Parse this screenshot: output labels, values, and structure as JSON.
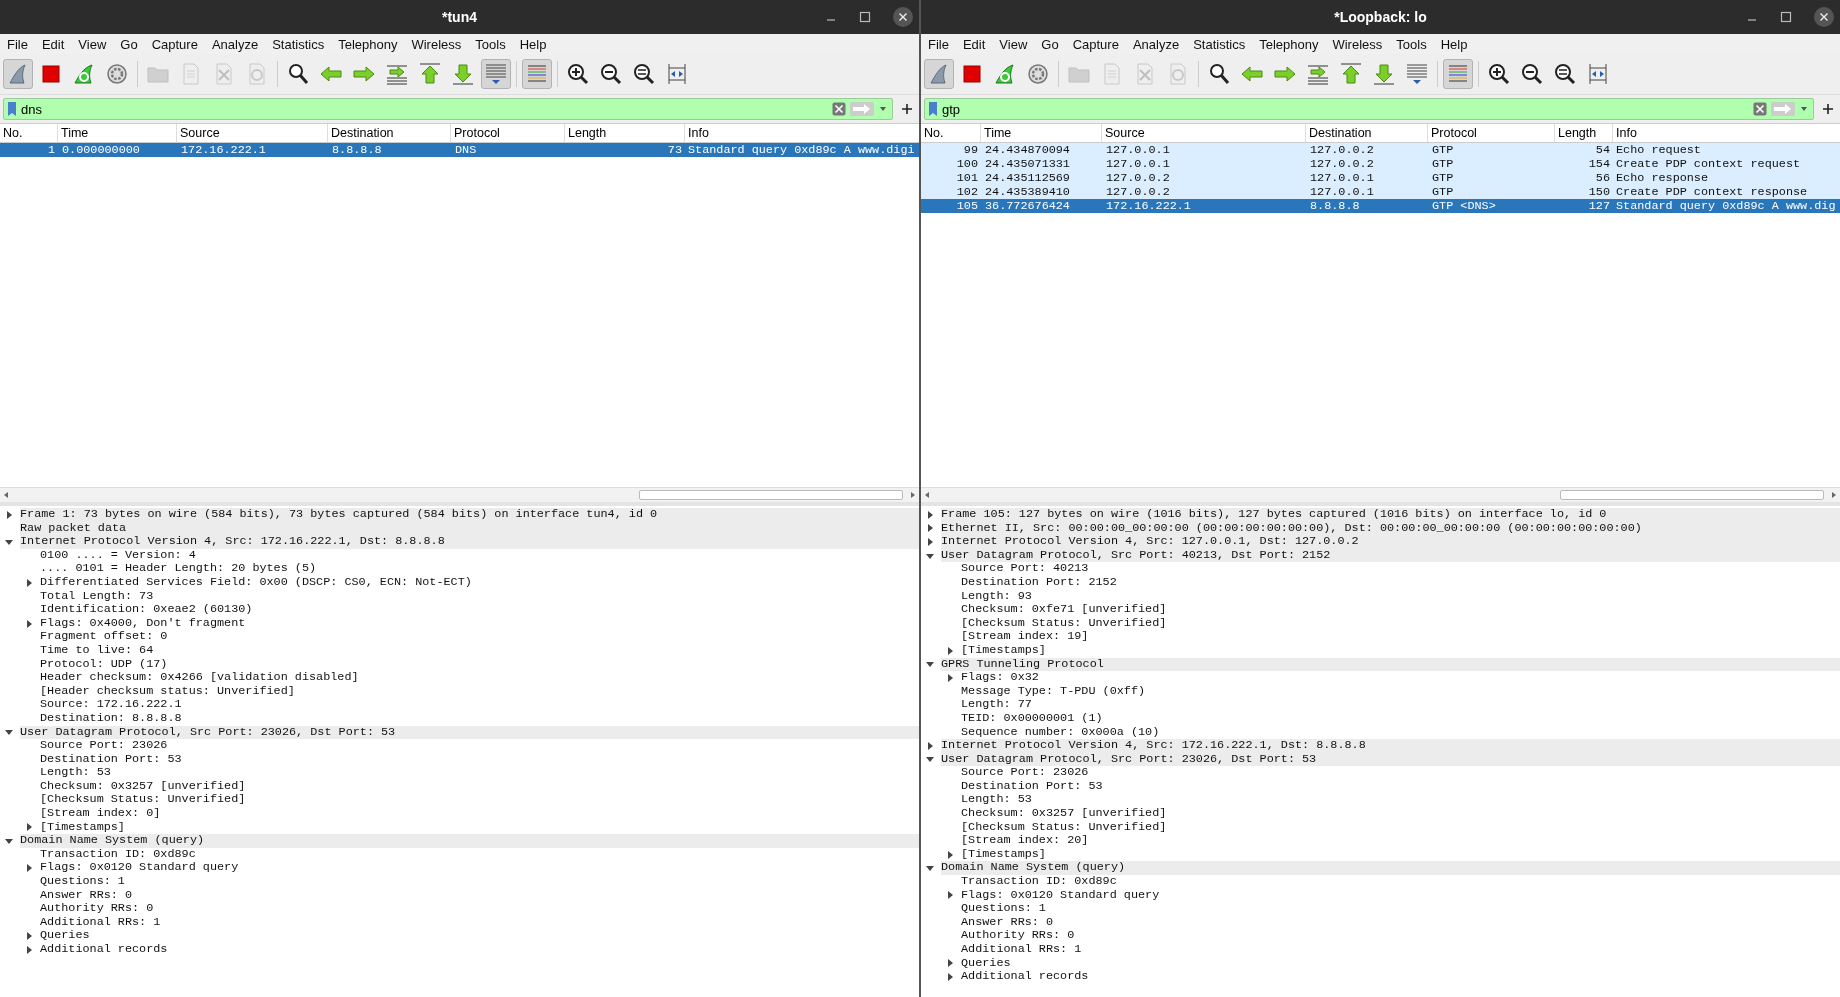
{
  "windows": [
    {
      "title": "*tun4",
      "menu": [
        "File",
        "Edit",
        "View",
        "Go",
        "Capture",
        "Analyze",
        "Statistics",
        "Telephony",
        "Wireless",
        "Tools",
        "Help"
      ],
      "toolbar": [
        {
          "kind": "start",
          "pressed": true,
          "disabled": false
        },
        {
          "kind": "stop",
          "pressed": false,
          "disabled": false
        },
        {
          "kind": "restart",
          "pressed": false,
          "disabled": false
        },
        {
          "kind": "options",
          "pressed": false,
          "disabled": false
        },
        {
          "kind": "separator"
        },
        {
          "kind": "open",
          "pressed": false,
          "disabled": true
        },
        {
          "kind": "save",
          "pressed": false,
          "disabled": true
        },
        {
          "kind": "close",
          "pressed": false,
          "disabled": true
        },
        {
          "kind": "reload",
          "pressed": false,
          "disabled": true
        },
        {
          "kind": "separator"
        },
        {
          "kind": "find",
          "pressed": false,
          "disabled": false
        },
        {
          "kind": "back",
          "pressed": false,
          "disabled": false
        },
        {
          "kind": "forward",
          "pressed": false,
          "disabled": false
        },
        {
          "kind": "goto",
          "pressed": false,
          "disabled": false
        },
        {
          "kind": "first",
          "pressed": false,
          "disabled": false
        },
        {
          "kind": "last",
          "pressed": false,
          "disabled": false
        },
        {
          "kind": "autoscroll",
          "pressed": true,
          "disabled": false
        },
        {
          "kind": "separator"
        },
        {
          "kind": "colorize",
          "pressed": true,
          "disabled": false
        },
        {
          "kind": "separator"
        },
        {
          "kind": "zoom_in",
          "pressed": false,
          "disabled": false
        },
        {
          "kind": "zoom_out",
          "pressed": false,
          "disabled": false
        },
        {
          "kind": "zoom_reset",
          "pressed": false,
          "disabled": false
        },
        {
          "kind": "resize",
          "pressed": false,
          "disabled": false
        }
      ],
      "filter": {
        "value": "dns"
      },
      "columns": [
        "No.",
        "Time",
        "Source",
        "Destination",
        "Protocol",
        "Length",
        "Info"
      ],
      "packets": [
        {
          "no": "1",
          "time": "0.000000000",
          "source": "172.16.222.1",
          "destination": "8.8.8.8",
          "protocol": "DNS",
          "length": "73",
          "info": "Standard query 0xd89c A www.digi",
          "selected": true
        }
      ],
      "details": [
        {
          "text": "Frame 1: 73 bytes on wire (584 bits), 73 bytes captured (584 bits) on interface tun4, id 0",
          "kind": "branch",
          "expanded": false
        },
        {
          "text": "Raw packet data",
          "kind": "leaf"
        },
        {
          "text": "Internet Protocol Version 4, Src: 172.16.222.1, Dst: 8.8.8.8",
          "kind": "branch",
          "expanded": true,
          "children": [
            {
              "text": "0100 .... = Version: 4",
              "kind": "leaf"
            },
            {
              "text": ".... 0101 = Header Length: 20 bytes (5)",
              "kind": "leaf"
            },
            {
              "text": "Differentiated Services Field: 0x00 (DSCP: CS0, ECN: Not-ECT)",
              "kind": "branch",
              "expanded": false
            },
            {
              "text": "Total Length: 73",
              "kind": "leaf"
            },
            {
              "text": "Identification: 0xeae2 (60130)",
              "kind": "leaf"
            },
            {
              "text": "Flags: 0x4000, Don't fragment",
              "kind": "branch",
              "expanded": false
            },
            {
              "text": "Fragment offset: 0",
              "kind": "leaf"
            },
            {
              "text": "Time to live: 64",
              "kind": "leaf"
            },
            {
              "text": "Protocol: UDP (17)",
              "kind": "leaf"
            },
            {
              "text": "Header checksum: 0x4266 [validation disabled]",
              "kind": "leaf"
            },
            {
              "text": "[Header checksum status: Unverified]",
              "kind": "leaf"
            },
            {
              "text": "Source: 172.16.222.1",
              "kind": "leaf"
            },
            {
              "text": "Destination: 8.8.8.8",
              "kind": "leaf"
            }
          ]
        },
        {
          "text": "User Datagram Protocol, Src Port: 23026, Dst Port: 53",
          "kind": "branch",
          "expanded": true,
          "children": [
            {
              "text": "Source Port: 23026",
              "kind": "leaf"
            },
            {
              "text": "Destination Port: 53",
              "kind": "leaf"
            },
            {
              "text": "Length: 53",
              "kind": "leaf"
            },
            {
              "text": "Checksum: 0x3257 [unverified]",
              "kind": "leaf"
            },
            {
              "text": "[Checksum Status: Unverified]",
              "kind": "leaf"
            },
            {
              "text": "[Stream index: 0]",
              "kind": "leaf"
            },
            {
              "text": "[Timestamps]",
              "kind": "branch",
              "expanded": false
            }
          ]
        },
        {
          "text": "Domain Name System (query)",
          "kind": "branch",
          "expanded": true,
          "children": [
            {
              "text": "Transaction ID: 0xd89c",
              "kind": "leaf"
            },
            {
              "text": "Flags: 0x0120 Standard query",
              "kind": "branch",
              "expanded": false
            },
            {
              "text": "Questions: 1",
              "kind": "leaf"
            },
            {
              "text": "Answer RRs: 0",
              "kind": "leaf"
            },
            {
              "text": "Authority RRs: 0",
              "kind": "leaf"
            },
            {
              "text": "Additional RRs: 1",
              "kind": "leaf"
            },
            {
              "text": "Queries",
              "kind": "branch",
              "expanded": false
            },
            {
              "text": "Additional records",
              "kind": "branch",
              "expanded": false
            }
          ]
        }
      ]
    },
    {
      "title": "*Loopback: lo",
      "menu": [
        "File",
        "Edit",
        "View",
        "Go",
        "Capture",
        "Analyze",
        "Statistics",
        "Telephony",
        "Wireless",
        "Tools",
        "Help"
      ],
      "toolbar": [
        {
          "kind": "start",
          "pressed": true,
          "disabled": false
        },
        {
          "kind": "stop",
          "pressed": false,
          "disabled": false
        },
        {
          "kind": "restart",
          "pressed": false,
          "disabled": false
        },
        {
          "kind": "options",
          "pressed": false,
          "disabled": false
        },
        {
          "kind": "separator"
        },
        {
          "kind": "open",
          "pressed": false,
          "disabled": true
        },
        {
          "kind": "save",
          "pressed": false,
          "disabled": true
        },
        {
          "kind": "close",
          "pressed": false,
          "disabled": true
        },
        {
          "kind": "reload",
          "pressed": false,
          "disabled": true
        },
        {
          "kind": "separator"
        },
        {
          "kind": "find",
          "pressed": false,
          "disabled": false
        },
        {
          "kind": "back",
          "pressed": false,
          "disabled": false
        },
        {
          "kind": "forward",
          "pressed": false,
          "disabled": false
        },
        {
          "kind": "goto",
          "pressed": false,
          "disabled": false
        },
        {
          "kind": "first",
          "pressed": false,
          "disabled": false
        },
        {
          "kind": "last",
          "pressed": false,
          "disabled": false
        },
        {
          "kind": "autoscroll",
          "pressed": false,
          "disabled": false
        },
        {
          "kind": "separator"
        },
        {
          "kind": "colorize",
          "pressed": true,
          "disabled": false
        },
        {
          "kind": "separator"
        },
        {
          "kind": "zoom_in",
          "pressed": false,
          "disabled": false
        },
        {
          "kind": "zoom_out",
          "pressed": false,
          "disabled": false
        },
        {
          "kind": "zoom_reset",
          "pressed": false,
          "disabled": false
        },
        {
          "kind": "resize",
          "pressed": false,
          "disabled": false
        }
      ],
      "filter": {
        "value": "gtp"
      },
      "columns": [
        "No.",
        "Time",
        "Source",
        "Destination",
        "Protocol",
        "Length",
        "Info"
      ],
      "packets": [
        {
          "no": "99",
          "time": "24.434870094",
          "source": "127.0.0.1",
          "destination": "127.0.0.2",
          "protocol": "GTP",
          "length": "54",
          "info": "Echo request",
          "selected": false,
          "color": "#daeeff"
        },
        {
          "no": "100",
          "time": "24.435071331",
          "source": "127.0.0.1",
          "destination": "127.0.0.2",
          "protocol": "GTP",
          "length": "154",
          "info": "Create PDP context request",
          "selected": false,
          "color": "#daeeff"
        },
        {
          "no": "101",
          "time": "24.435112569",
          "source": "127.0.0.2",
          "destination": "127.0.0.1",
          "protocol": "GTP",
          "length": "56",
          "info": "Echo response",
          "selected": false,
          "color": "#daeeff"
        },
        {
          "no": "102",
          "time": "24.435389410",
          "source": "127.0.0.2",
          "destination": "127.0.0.1",
          "protocol": "GTP",
          "length": "150",
          "info": "Create PDP context response",
          "selected": false,
          "color": "#daeeff"
        },
        {
          "no": "105",
          "time": "36.772676424",
          "source": "172.16.222.1",
          "destination": "8.8.8.8",
          "protocol": "GTP <DNS>",
          "length": "127",
          "info": "Standard query 0xd89c A www.dig",
          "selected": true
        }
      ],
      "details": [
        {
          "text": "Frame 105: 127 bytes on wire (1016 bits), 127 bytes captured (1016 bits) on interface lo, id 0",
          "kind": "branch",
          "expanded": false
        },
        {
          "text": "Ethernet II, Src: 00:00:00_00:00:00 (00:00:00:00:00:00), Dst: 00:00:00_00:00:00 (00:00:00:00:00:00)",
          "kind": "branch",
          "expanded": false
        },
        {
          "text": "Internet Protocol Version 4, Src: 127.0.0.1, Dst: 127.0.0.2",
          "kind": "branch",
          "expanded": false
        },
        {
          "text": "User Datagram Protocol, Src Port: 40213, Dst Port: 2152",
          "kind": "branch",
          "expanded": true,
          "children": [
            {
              "text": "Source Port: 40213",
              "kind": "leaf"
            },
            {
              "text": "Destination Port: 2152",
              "kind": "leaf"
            },
            {
              "text": "Length: 93",
              "kind": "leaf"
            },
            {
              "text": "Checksum: 0xfe71 [unverified]",
              "kind": "leaf"
            },
            {
              "text": "[Checksum Status: Unverified]",
              "kind": "leaf"
            },
            {
              "text": "[Stream index: 19]",
              "kind": "leaf"
            },
            {
              "text": "[Timestamps]",
              "kind": "branch",
              "expanded": false
            }
          ]
        },
        {
          "text": "GPRS Tunneling Protocol",
          "kind": "branch",
          "expanded": true,
          "children": [
            {
              "text": "Flags: 0x32",
              "kind": "branch",
              "expanded": false
            },
            {
              "text": "Message Type: T-PDU (0xff)",
              "kind": "leaf"
            },
            {
              "text": "Length: 77",
              "kind": "leaf"
            },
            {
              "text": "TEID: 0x00000001 (1)",
              "kind": "leaf"
            },
            {
              "text": "Sequence number: 0x000a (10)",
              "kind": "leaf"
            }
          ]
        },
        {
          "text": "Internet Protocol Version 4, Src: 172.16.222.1, Dst: 8.8.8.8",
          "kind": "branch",
          "expanded": false
        },
        {
          "text": "User Datagram Protocol, Src Port: 23026, Dst Port: 53",
          "kind": "branch",
          "expanded": true,
          "children": [
            {
              "text": "Source Port: 23026",
              "kind": "leaf"
            },
            {
              "text": "Destination Port: 53",
              "kind": "leaf"
            },
            {
              "text": "Length: 53",
              "kind": "leaf"
            },
            {
              "text": "Checksum: 0x3257 [unverified]",
              "kind": "leaf"
            },
            {
              "text": "[Checksum Status: Unverified]",
              "kind": "leaf"
            },
            {
              "text": "[Stream index: 20]",
              "kind": "leaf"
            },
            {
              "text": "[Timestamps]",
              "kind": "branch",
              "expanded": false
            }
          ]
        },
        {
          "text": "Domain Name System (query)",
          "kind": "branch",
          "expanded": true,
          "children": [
            {
              "text": "Transaction ID: 0xd89c",
              "kind": "leaf"
            },
            {
              "text": "Flags: 0x0120 Standard query",
              "kind": "branch",
              "expanded": false
            },
            {
              "text": "Questions: 1",
              "kind": "leaf"
            },
            {
              "text": "Answer RRs: 0",
              "kind": "leaf"
            },
            {
              "text": "Authority RRs: 0",
              "kind": "leaf"
            },
            {
              "text": "Additional RRs: 1",
              "kind": "leaf"
            },
            {
              "text": "Queries",
              "kind": "branch",
              "expanded": false
            },
            {
              "text": "Additional records",
              "kind": "branch",
              "expanded": false
            }
          ]
        }
      ]
    }
  ]
}
